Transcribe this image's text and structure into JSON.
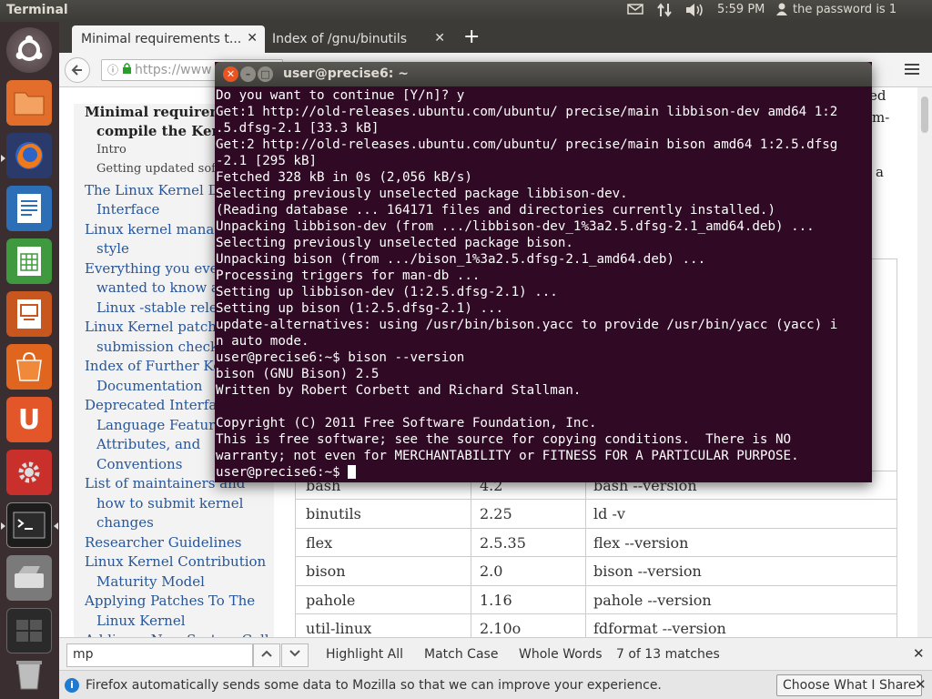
{
  "topbar": {
    "title": "Terminal",
    "time": "5:59 PM",
    "user": "the password is 1",
    "icons": [
      "mail-icon",
      "network-icon",
      "volume-icon",
      "user-icon"
    ]
  },
  "launcher": {
    "items": [
      "dash-home",
      "files",
      "firefox",
      "libreoffice-writer",
      "libreoffice-calc",
      "libreoffice-impress",
      "ubuntu-software-center",
      "ubuntu-one",
      "system-settings",
      "terminal",
      "scanner",
      "workspace-switcher",
      "trash"
    ]
  },
  "browser": {
    "tabs": [
      {
        "label": "Minimal requirements t..."
      },
      {
        "label": "Index of /gnu/binutils"
      }
    ],
    "url": "https://www"
  },
  "toc": [
    {
      "text": "Minimal requirem",
      "style": "head",
      "indent": 0
    },
    {
      "text": "compile the Ker",
      "style": "head",
      "indent": 1
    },
    {
      "text": "Intro",
      "style": "sub",
      "indent": 1
    },
    {
      "text": "Getting updated sof",
      "style": "sub",
      "indent": 1
    },
    {
      "text": "The Linux Kernel D",
      "style": "link",
      "indent": 0
    },
    {
      "text": "Interface",
      "style": "link",
      "indent": 1
    },
    {
      "text": "Linux kernel manag",
      "style": "link",
      "indent": 0
    },
    {
      "text": "style",
      "style": "link",
      "indent": 1
    },
    {
      "text": "Everything you eve",
      "style": "link",
      "indent": 0
    },
    {
      "text": "wanted to know a",
      "style": "link",
      "indent": 1
    },
    {
      "text": "Linux -stable rele",
      "style": "link",
      "indent": 1
    },
    {
      "text": "Linux Kernel patch",
      "style": "link",
      "indent": 0
    },
    {
      "text": "submission check",
      "style": "link",
      "indent": 1
    },
    {
      "text": "Index of Further Ke",
      "style": "link",
      "indent": 0
    },
    {
      "text": "Documentation",
      "style": "link",
      "indent": 1
    },
    {
      "text": "Deprecated Interfac",
      "style": "link",
      "indent": 0
    },
    {
      "text": "Language Feature",
      "style": "link",
      "indent": 1
    },
    {
      "text": "Attributes, and",
      "style": "link",
      "indent": 1
    },
    {
      "text": "Conventions",
      "style": "link",
      "indent": 1
    },
    {
      "text": "List of maintainers and",
      "style": "link",
      "indent": 0
    },
    {
      "text": "how to submit kernel",
      "style": "link",
      "indent": 1
    },
    {
      "text": "changes",
      "style": "link",
      "indent": 1
    },
    {
      "text": "Researcher Guidelines",
      "style": "link",
      "indent": 0
    },
    {
      "text": "Linux Kernel Contribution",
      "style": "link",
      "indent": 0
    },
    {
      "text": "Maturity Model",
      "style": "link",
      "indent": 1
    },
    {
      "text": "Applying Patches To The",
      "style": "link",
      "indent": 0
    },
    {
      "text": "Linux Kernel",
      "style": "link",
      "indent": 1
    },
    {
      "text": "Adding a New System Call",
      "style": "link",
      "indent": 0
    }
  ],
  "page_right_text": [
    "ed",
    "om-",
    "a"
  ],
  "requirements_table": [
    {
      "program": "bash",
      "version": "4.2",
      "command": "bash --version"
    },
    {
      "program": "binutils",
      "version": "2.25",
      "command": "ld -v"
    },
    {
      "program": "flex",
      "version": "2.5.35",
      "command": "flex --version"
    },
    {
      "program": "bison",
      "version": "2.0",
      "command": "bison --version"
    },
    {
      "program": "pahole",
      "version": "1.16",
      "command": "pahole --version"
    },
    {
      "program": "util-linux",
      "version": "2.10o",
      "command": "fdformat --version"
    }
  ],
  "findbar": {
    "query": "mp",
    "highlight_all": "Highlight All",
    "match_case": "Match Case",
    "whole_words": "Whole Words",
    "status": "7 of 13 matches"
  },
  "notification": {
    "message": "Firefox automatically sends some data to Mozilla so that we can improve your experience.",
    "button": "Choose What I Share"
  },
  "terminal": {
    "title": "user@precise6: ~",
    "lines": [
      "Do you want to continue [Y/n]? y",
      "Get:1 http://old-releases.ubuntu.com/ubuntu/ precise/main libbison-dev amd64 1:2",
      ".5.dfsg-2.1 [33.3 kB]",
      "Get:2 http://old-releases.ubuntu.com/ubuntu/ precise/main bison amd64 1:2.5.dfsg",
      "-2.1 [295 kB]",
      "Fetched 328 kB in 0s (2,056 kB/s)",
      "Selecting previously unselected package libbison-dev.",
      "(Reading database ... 164171 files and directories currently installed.)",
      "Unpacking libbison-dev (from .../libbison-dev_1%3a2.5.dfsg-2.1_amd64.deb) ...",
      "Selecting previously unselected package bison.",
      "Unpacking bison (from .../bison_1%3a2.5.dfsg-2.1_amd64.deb) ...",
      "Processing triggers for man-db ...",
      "Setting up libbison-dev (1:2.5.dfsg-2.1) ...",
      "Setting up bison (1:2.5.dfsg-2.1) ...",
      "update-alternatives: using /usr/bin/bison.yacc to provide /usr/bin/yacc (yacc) i",
      "n auto mode.",
      "user@precise6:~$ bison --version",
      "bison (GNU Bison) 2.5",
      "Written by Robert Corbett and Richard Stallman.",
      "",
      "Copyright (C) 2011 Free Software Foundation, Inc.",
      "This is free software; see the source for copying conditions.  There is NO",
      "warranty; not even for MERCHANTABILITY or FITNESS FOR A PARTICULAR PURPOSE.",
      "user@precise6:~$ "
    ]
  },
  "colors": {
    "terminal_bg": "#300a24",
    "launcher_bg": "#3a2e31",
    "panel_bg": "#3c3b37",
    "close_button": "#e95420"
  }
}
